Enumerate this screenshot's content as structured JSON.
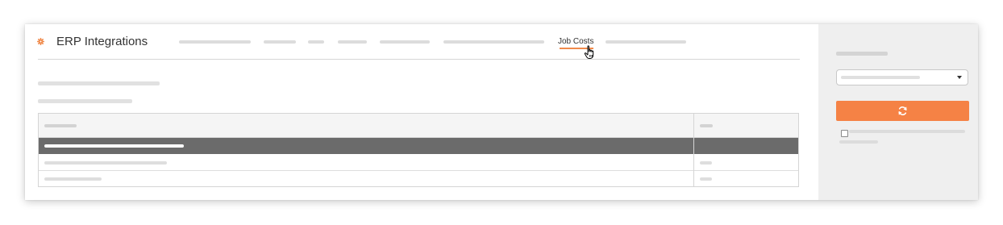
{
  "header": {
    "app_title": "ERP Integrations",
    "active_tab_label": "Job Costs"
  },
  "colors": {
    "accent": "#f58245",
    "selected_row": "#6b6b6b",
    "sidebar_bg": "#efefef"
  },
  "icons": {
    "app": "gear-icon",
    "cursor": "hand-pointer-icon",
    "refresh": "refresh-icon",
    "dropdown": "caret-down-icon"
  },
  "table": {
    "selected_row_index": 0
  },
  "sidebar": {
    "checkbox_checked": false
  }
}
